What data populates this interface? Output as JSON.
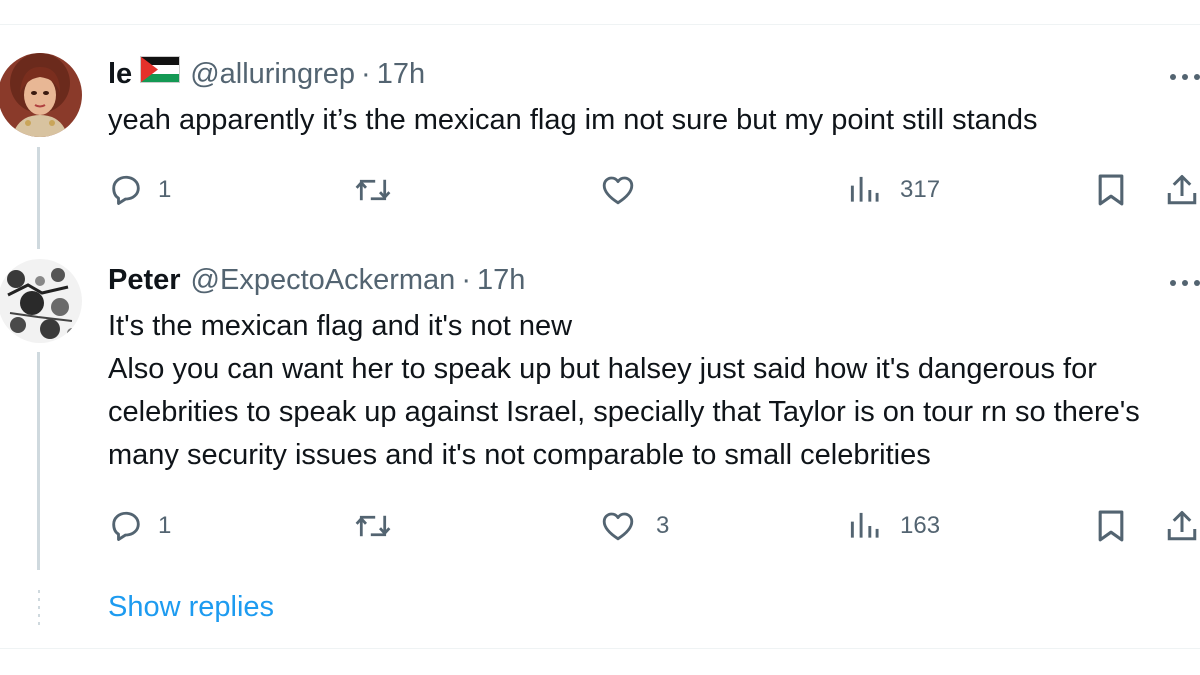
{
  "colors": {
    "text_primary": "#0f1419",
    "text_secondary": "#536471",
    "link": "#1d9bf0",
    "thread_line": "#cfd9de",
    "divider": "#eff3f4"
  },
  "tweets": [
    {
      "display_name": "le",
      "flag_icon": "palestine-flag-icon",
      "handle": "@alluringrep",
      "separator": "·",
      "time": "17h",
      "text": "yeah apparently it’s the mexican flag im not sure but my point still stands",
      "actions": {
        "reply_count": "1",
        "retweet_count": "",
        "like_count": "",
        "views_count": "317"
      }
    },
    {
      "display_name": "Peter",
      "handle": "@ExpectoAckerman",
      "separator": "·",
      "time": "17h",
      "text": "It's the mexican flag and it's not new\nAlso you can want her to speak up but halsey just said how it's dangerous for celebrities to speak up against Israel, specially that Taylor is on tour rn so there's many security issues and it's not comparable to small celebrities",
      "actions": {
        "reply_count": "1",
        "retweet_count": "",
        "like_count": "3",
        "views_count": "163"
      }
    }
  ],
  "show_replies_label": "Show replies"
}
